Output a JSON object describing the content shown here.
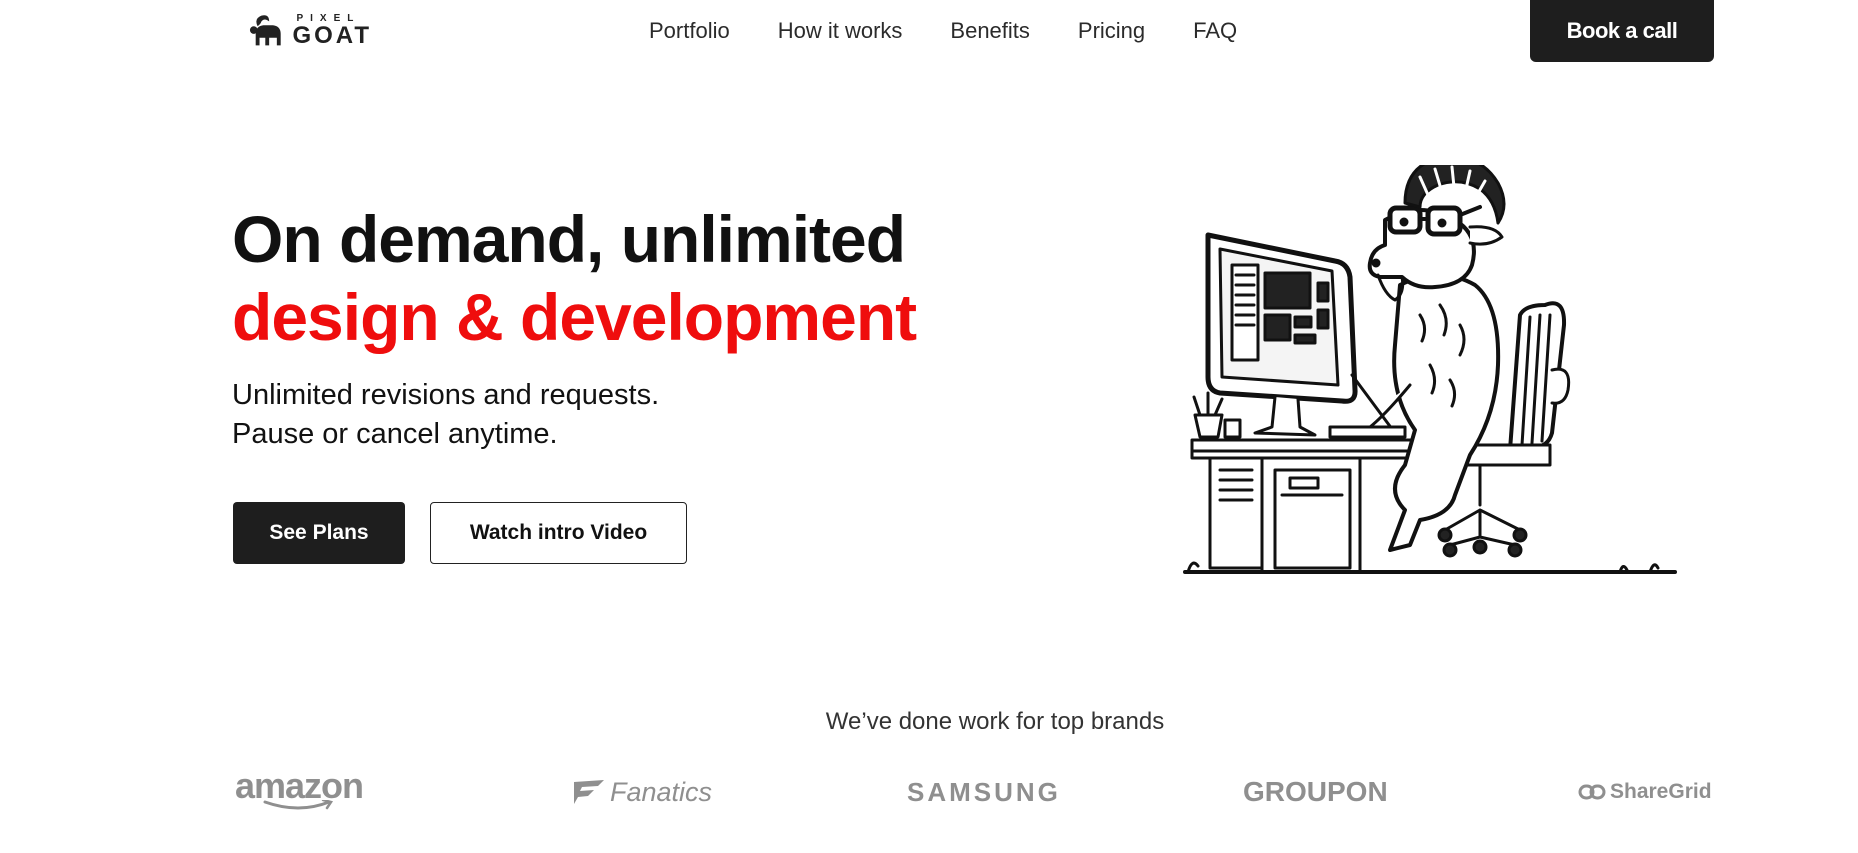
{
  "header": {
    "logo": {
      "top": "PIXEL",
      "bottom": "GOAT"
    },
    "nav": [
      {
        "label": "Portfolio"
      },
      {
        "label": "How it works"
      },
      {
        "label": "Benefits"
      },
      {
        "label": "Pricing"
      },
      {
        "label": "FAQ"
      }
    ],
    "cta_label": "Book a call"
  },
  "hero": {
    "title_line1": "On demand, unlimited",
    "title_line2": "design & development",
    "subtitle_line1": "Unlimited revisions and requests.",
    "subtitle_line2": "Pause or cancel anytime.",
    "primary_button": "See Plans",
    "secondary_button": "Watch intro Video",
    "accent_color": "#ef0d0d",
    "illustration": "goat-at-computer-illustration"
  },
  "brands": {
    "title": "We’ve done work for top brands",
    "items": [
      {
        "name": "amazon",
        "icon": "amazon-smile-icon"
      },
      {
        "name": "Fanatics",
        "icon": "fanatics-flag-icon"
      },
      {
        "name": "SAMSUNG"
      },
      {
        "name": "GROUPON"
      },
      {
        "name": "ShareGrid",
        "icon": "sharegrid-link-icon"
      }
    ]
  }
}
